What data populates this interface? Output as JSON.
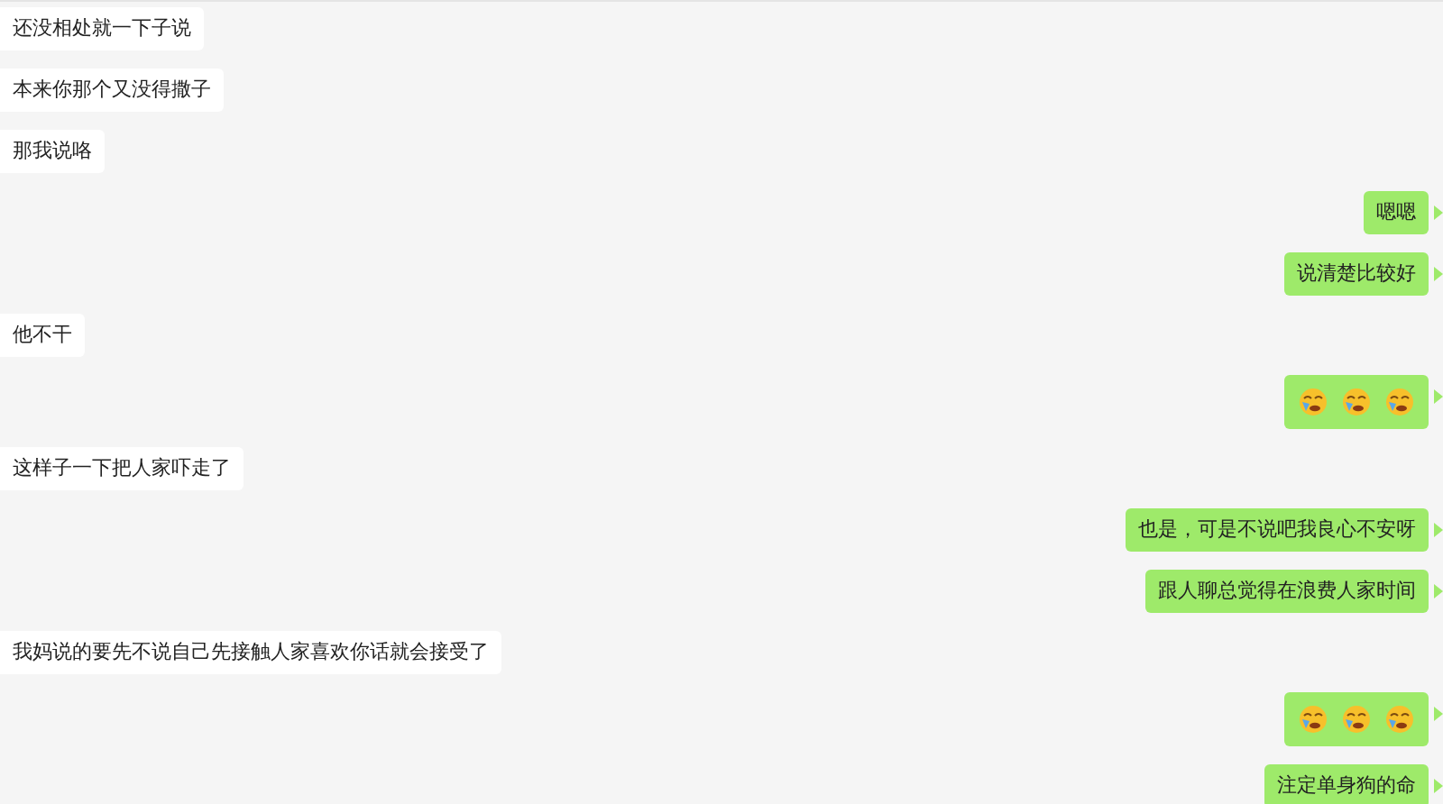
{
  "messages": [
    {
      "outgoing": false,
      "kind": "text",
      "text": "还没相处就一下子说"
    },
    {
      "outgoing": false,
      "kind": "text",
      "text": "本来你那个又没得撒子"
    },
    {
      "outgoing": false,
      "kind": "text",
      "text": "那我说咯"
    },
    {
      "outgoing": true,
      "kind": "text",
      "text": "嗯嗯"
    },
    {
      "outgoing": true,
      "kind": "text",
      "text": "说清楚比较好"
    },
    {
      "outgoing": false,
      "kind": "text",
      "text": "他不干"
    },
    {
      "outgoing": true,
      "kind": "emoji"
    },
    {
      "outgoing": false,
      "kind": "text",
      "text": "这样子一下把人家吓走了"
    },
    {
      "outgoing": true,
      "kind": "text",
      "text": "也是，可是不说吧我良心不安呀"
    },
    {
      "outgoing": true,
      "kind": "text",
      "text": "跟人聊总觉得在浪费人家时间"
    },
    {
      "outgoing": false,
      "kind": "text",
      "text": "我妈说的要先不说自己先接触人家喜欢你话就会接受了"
    },
    {
      "outgoing": true,
      "kind": "emoji"
    },
    {
      "outgoing": true,
      "kind": "text",
      "text": "注定单身狗的命"
    }
  ]
}
